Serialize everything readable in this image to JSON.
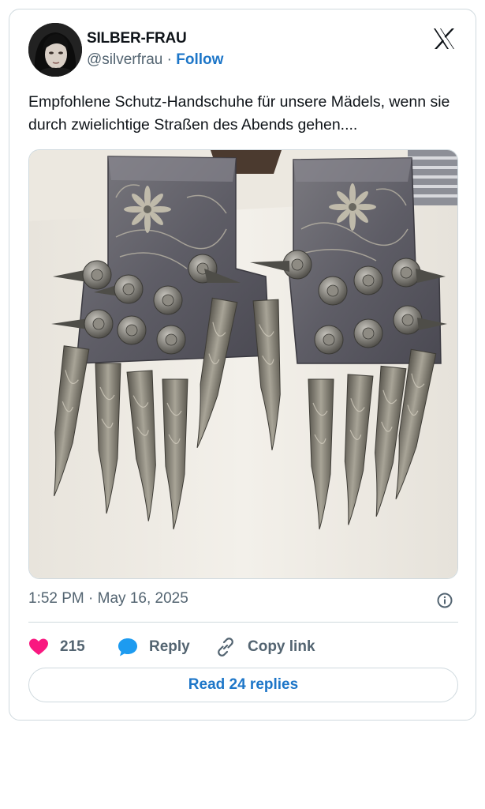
{
  "tweet": {
    "author_name": "SILBER-FRAU",
    "author_handle": "@silverfrau",
    "separator": "·",
    "follow_label": "Follow",
    "text": "Empfohlene Schutz-Handschuhe für unsere Mädels, wenn sie durch zwielichtige Straßen des Abends gehen....",
    "timestamp": "1:52 PM · May 16, 2025",
    "likes": "215",
    "reply_label": "Reply",
    "copy_link_label": "Copy link",
    "read_replies_label": "Read 24 replies"
  },
  "icons": {
    "brand": "x-logo-icon",
    "info": "info-icon",
    "like": "heart-icon",
    "reply": "speech-bubble-icon",
    "copy": "link-icon"
  },
  "colors": {
    "accent": "#1d76c8",
    "like": "#f91880",
    "reply": "#1d9bf0",
    "muted": "#536471",
    "border": "#cfd9de"
  }
}
